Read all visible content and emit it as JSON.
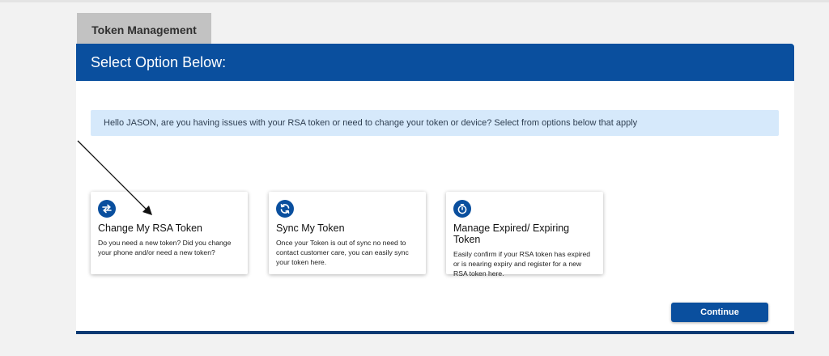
{
  "tab": {
    "label": "Token Management"
  },
  "panel": {
    "title": "Select Option Below:"
  },
  "banner": {
    "text": "Hello JASON, are you having issues with your RSA token or need to change your token or device? Select from options below that apply"
  },
  "cards": [
    {
      "icon": "swap-arrows-icon",
      "title": "Change My RSA Token",
      "description": "Do you need a new token? Did you change your phone and/or need a new token?"
    },
    {
      "icon": "sync-icon",
      "title": "Sync My Token",
      "description": "Once your Token is out of sync no need to contact customer care, you can easily sync your token here."
    },
    {
      "icon": "stopwatch-icon",
      "title": "Manage Expired/ Expiring Token",
      "description": "Easily confirm if your RSA token has expired or is nearing expiry and register for a new RSA token here."
    }
  ],
  "actions": {
    "continue_label": "Continue"
  },
  "colors": {
    "brand_blue": "#0a4f9e",
    "banner_bg": "#d6e9fb",
    "footer_bar": "#0a3a73"
  }
}
